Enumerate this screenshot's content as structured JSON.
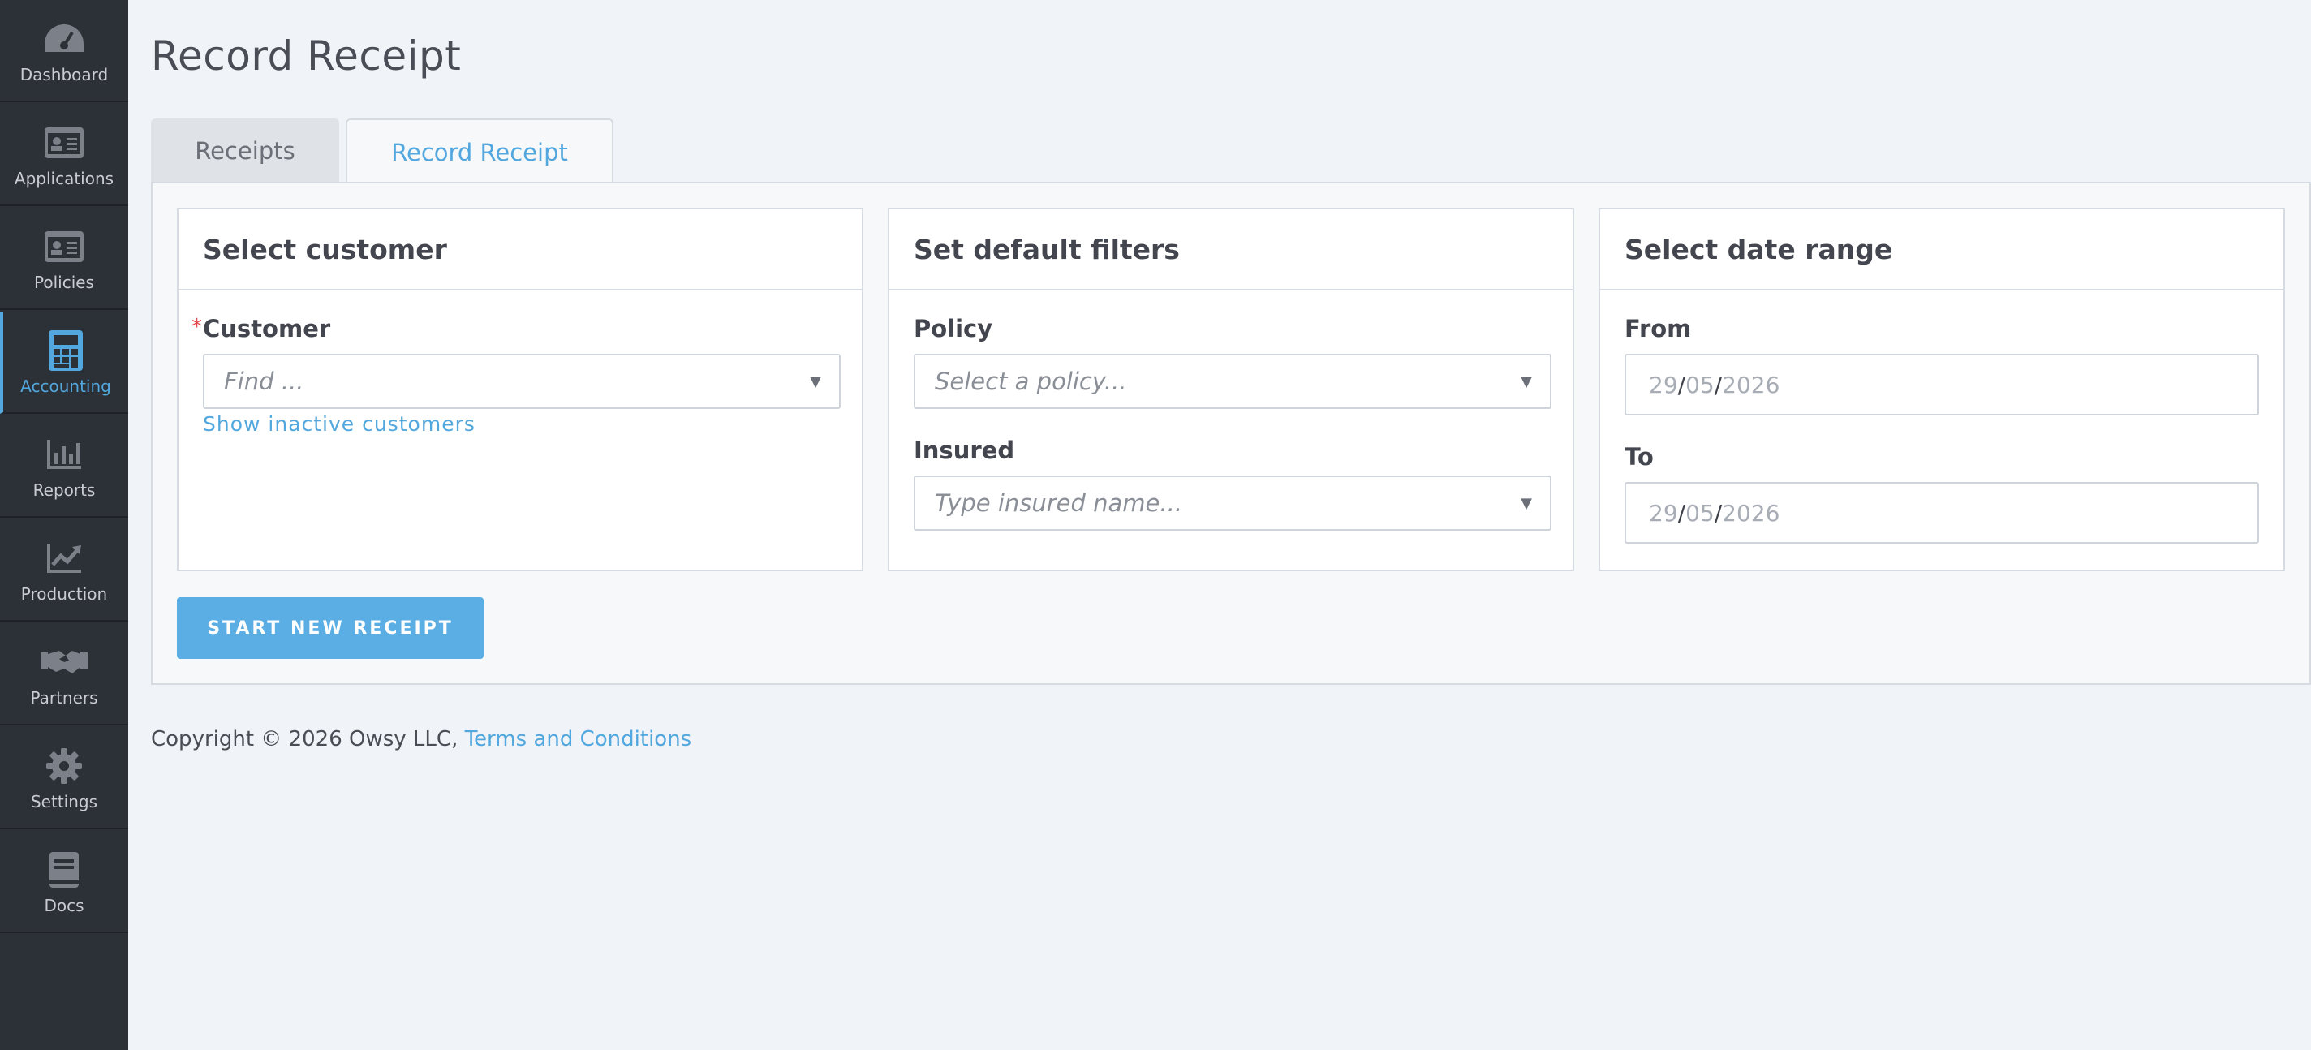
{
  "sidebar": {
    "items": [
      {
        "label": "Dashboard",
        "icon": "dashboard-icon"
      },
      {
        "label": "Applications",
        "icon": "id-card-icon"
      },
      {
        "label": "Policies",
        "icon": "id-card-icon"
      },
      {
        "label": "Accounting",
        "icon": "calculator-icon",
        "active": true
      },
      {
        "label": "Reports",
        "icon": "bar-chart-icon"
      },
      {
        "label": "Production",
        "icon": "line-chart-icon"
      },
      {
        "label": "Partners",
        "icon": "handshake-icon"
      },
      {
        "label": "Settings",
        "icon": "gear-icon"
      },
      {
        "label": "Docs",
        "icon": "book-icon"
      }
    ],
    "active_color": "#52a8de"
  },
  "page": {
    "title": "Record Receipt"
  },
  "tabs": [
    {
      "label": "Receipts"
    },
    {
      "label": "Record Receipt",
      "active": true
    }
  ],
  "customer_card": {
    "title": "Select customer",
    "required_mark": "*",
    "customer_label": "Customer",
    "customer_placeholder": "Find ...",
    "inactive_link": "Show inactive customers"
  },
  "filters_card": {
    "title": "Set default filters",
    "policy_label": "Policy",
    "policy_placeholder": "Select a policy...",
    "insured_label": "Insured",
    "insured_placeholder": "Type insured name..."
  },
  "date_card": {
    "title": "Select date range",
    "from_label": "From",
    "from_date": {
      "day": "29",
      "month": "05",
      "year": "2026"
    },
    "to_label": "To",
    "to_date": {
      "day": "29",
      "month": "05",
      "year": "2026"
    }
  },
  "actions": {
    "start_button": "START NEW RECEIPT"
  },
  "footer": {
    "copyright": "Copyright © 2026 Owsy LLC,",
    "terms_link": "Terms and Conditions"
  }
}
